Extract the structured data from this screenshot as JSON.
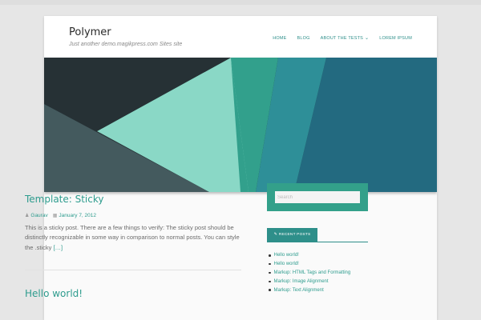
{
  "site": {
    "title": "Polymer",
    "tagline": "Just another demo.magikpress.com Sites site"
  },
  "nav": {
    "items": [
      {
        "label": "HOME"
      },
      {
        "label": "BLOG"
      },
      {
        "label": "ABOUT THE TESTS",
        "has_dropdown": true
      },
      {
        "label": "LOREM IPSUM"
      }
    ]
  },
  "hero": {
    "colors": {
      "dark": "#263135",
      "slate": "#445a5e",
      "mint": "#8ad8c6",
      "teal": "#32a08c",
      "teal_blue": "#2e8f98",
      "blue": "#236a80"
    }
  },
  "posts": [
    {
      "title": "Template: Sticky",
      "author": "Gaurav",
      "date": "January 7, 2012",
      "excerpt": "This is a sticky post. There are a few things to verify: The sticky post should be distinctly recognizable in some way in comparison to normal posts. You can style the .sticky",
      "more": "[…]"
    },
    {
      "title": "Hello world!"
    }
  ],
  "sidebar": {
    "search_placeholder": "Search",
    "recent_posts_label": "RECENT POSTS",
    "recent_posts": [
      "Hello world!",
      "Hello world!",
      "Markup: HTML Tags and Formatting",
      "Markup: Image Alignment",
      "Markup: Text Alignment"
    ]
  },
  "colors": {
    "accent": "#2e9c8e",
    "sidebar_accent": "#33a08a"
  }
}
